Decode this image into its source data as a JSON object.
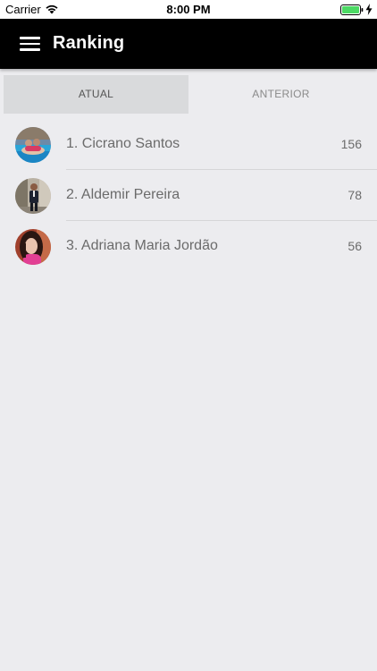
{
  "status_bar": {
    "carrier": "Carrier",
    "time": "8:00 PM",
    "battery_color": "#4cd964"
  },
  "app_bar": {
    "title": "Ranking",
    "menu_icon": "hamburger-menu-icon",
    "background": "#000000"
  },
  "tabs": [
    {
      "label": "ATUAL",
      "selected": true
    },
    {
      "label": "ANTERIOR",
      "selected": false
    }
  ],
  "ranking": [
    {
      "name": "1. Cicrano Santos",
      "score": "156",
      "avatar": "avatar-photo-pool"
    },
    {
      "name": "2. Aldemir Pereira",
      "score": "78",
      "avatar": "avatar-photo-suit"
    },
    {
      "name": "3. Adriana Maria Jordão",
      "score": "56",
      "avatar": "avatar-photo-woman"
    }
  ]
}
